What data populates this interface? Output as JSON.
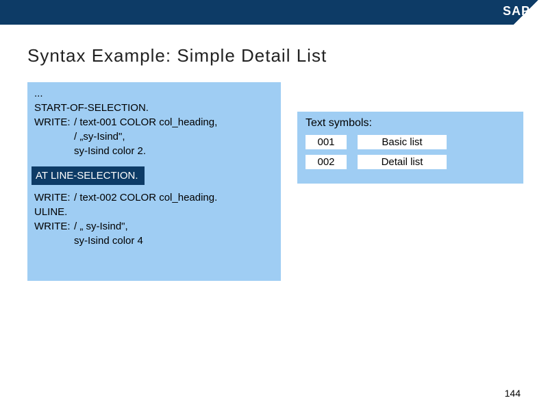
{
  "brand": "SAP",
  "title": "Syntax Example:  Simple Detail List",
  "code": {
    "l1": "...",
    "l2": "START-OF-SELECTION.",
    "l3a": "WRITE:",
    "l3b": "/ text-001 COLOR col_heading,",
    "l4": "/ „sy-Isind\",",
    "l5": "sy-Isind color 2.",
    "hl": "AT LINE-SELECTION.",
    "l6a": "WRITE:",
    "l6b": "/ text-002 COLOR col_heading.",
    "l7": "ULINE.",
    "l8a": "WRITE:",
    "l8b": "/ „ sy-Isind\",",
    "l9": "sy-Isind color 4"
  },
  "symbols": {
    "header": "Text symbols:",
    "rows": [
      {
        "id": "001",
        "text": "Basic list"
      },
      {
        "id": "002",
        "text": "Detail list"
      }
    ]
  },
  "page": "144"
}
